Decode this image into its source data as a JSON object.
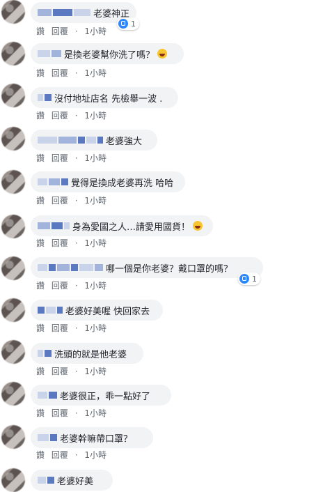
{
  "actions": {
    "like": "讚",
    "reply": "回覆",
    "sep": "·",
    "time": "1小時"
  },
  "comments": [
    {
      "text": "老婆神正",
      "likes": "1",
      "emoji": false
    },
    {
      "text": "是換老婆幫你洗了嗎？",
      "likes": "",
      "emoji": true
    },
    {
      "text": "沒付地址店名 先檢舉一波 .",
      "likes": "",
      "emoji": false
    },
    {
      "text": "老婆強大",
      "likes": "",
      "emoji": false
    },
    {
      "text": "覺得是換成老婆再洗 哈哈",
      "likes": "",
      "emoji": false
    },
    {
      "text": "身為愛國之人…請愛用國貨！",
      "likes": "",
      "emoji": true
    },
    {
      "text": "哪一個是你老婆？戴口罩的嗎？",
      "likes": "1",
      "emoji": false
    },
    {
      "text": "老婆好美喔 快回家去",
      "likes": "",
      "emoji": false
    },
    {
      "text": "洗頭的就是他老婆",
      "likes": "",
      "emoji": false
    },
    {
      "text": "老婆很正，乖一點好了",
      "likes": "",
      "emoji": false
    },
    {
      "text": "老婆幹嘛帶口罩？",
      "likes": "",
      "emoji": false
    },
    {
      "text": "老婆好美",
      "likes": "",
      "emoji": false
    }
  ],
  "colors": {
    "bubble": "#f2f3f5",
    "like_blue": "#2d88ff",
    "action_text": "#606770"
  }
}
